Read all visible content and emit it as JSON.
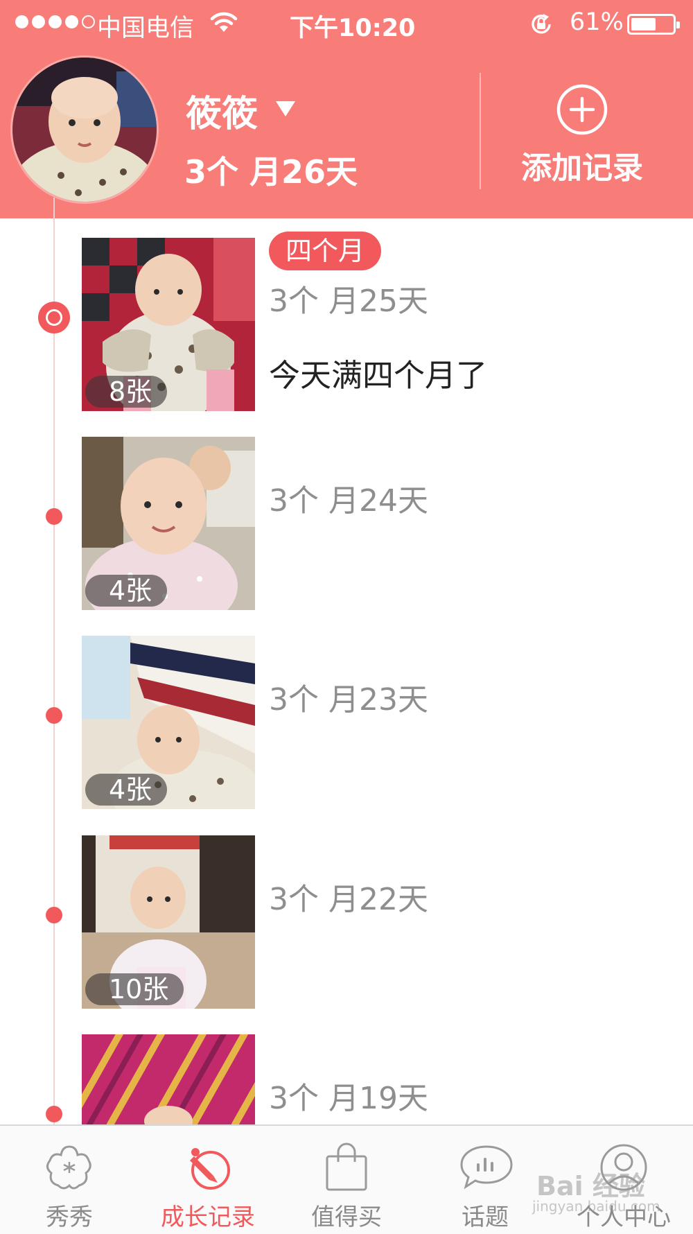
{
  "status_bar": {
    "carrier": "中国电信",
    "time": "下午10:20",
    "battery_percent": "61%",
    "battery_level": 0.61,
    "signal_bars_filled": 4,
    "signal_bars_total": 5
  },
  "profile": {
    "name": "筱筱",
    "age": "3个 月26天",
    "add_record_label": "添加记录"
  },
  "timeline": [
    {
      "month_tag": "四个月",
      "age": "3个 月25天",
      "photo_count": "8张",
      "note": "今天满四个月了"
    },
    {
      "age": "3个 月24天",
      "photo_count": "4张"
    },
    {
      "age": "3个 月23天",
      "photo_count": "4张"
    },
    {
      "age": "3个 月22天",
      "photo_count": "10张"
    },
    {
      "age": "3个 月19天"
    }
  ],
  "tabs": [
    {
      "label": "秀秀",
      "icon": "flower-star-icon"
    },
    {
      "label": "成长记录",
      "icon": "pencil-badge-icon",
      "active": true
    },
    {
      "label": "值得买",
      "icon": "shopping-bag-icon"
    },
    {
      "label": "话题",
      "icon": "chat-bubble-icon"
    },
    {
      "label": "个人中心",
      "icon": "person-icon"
    }
  ],
  "watermark": {
    "text": "Bai 经验",
    "sub": "jingyan.baidu.com"
  },
  "colors": {
    "header": "#f87c78",
    "accent": "#f2595c",
    "muted_text": "#8e8e8e"
  }
}
